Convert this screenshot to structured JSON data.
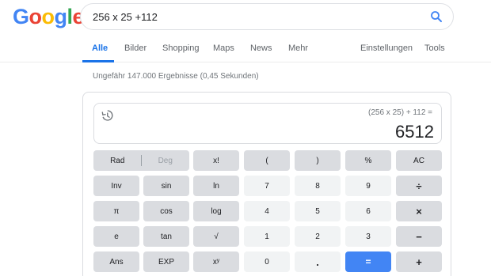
{
  "logo": {
    "letters": [
      "G",
      "o",
      "o",
      "g",
      "l",
      "e"
    ],
    "colors": [
      "#4285f4",
      "#ea4335",
      "#fbbc05",
      "#4285f4",
      "#34a853",
      "#ea4335"
    ]
  },
  "search": {
    "query": "256 x 25 +112",
    "icon": "search-icon"
  },
  "tabs": {
    "items": [
      "Alle",
      "Bilder",
      "Shopping",
      "Maps",
      "News",
      "Mehr"
    ],
    "settings": "Einstellungen",
    "tools": "Tools",
    "active": "Alle"
  },
  "stats": {
    "text": "Ungefähr 147.000 Ergebnisse (0,45 Sekunden)"
  },
  "calculator": {
    "expression": "(256 x 25) + 112 =",
    "result": "6512",
    "history_icon": "history-icon",
    "rad": "Rad",
    "deg": "Deg",
    "keys": [
      [
        "x!",
        "(",
        ")",
        "%",
        "AC"
      ],
      [
        "Inv",
        "sin",
        "ln",
        "7",
        "8",
        "9",
        "÷"
      ],
      [
        "π",
        "cos",
        "log",
        "4",
        "5",
        "6",
        "×"
      ],
      [
        "e",
        "tan",
        "√",
        "1",
        "2",
        "3",
        "−"
      ],
      [
        "Ans",
        "EXP",
        "xʸ",
        "0",
        ".",
        "=",
        "+"
      ]
    ]
  },
  "colors": {
    "accent": "#1a73e8",
    "equals": "#4285f4",
    "fn_key": "#dadce0",
    "num_key": "#f1f3f4"
  }
}
